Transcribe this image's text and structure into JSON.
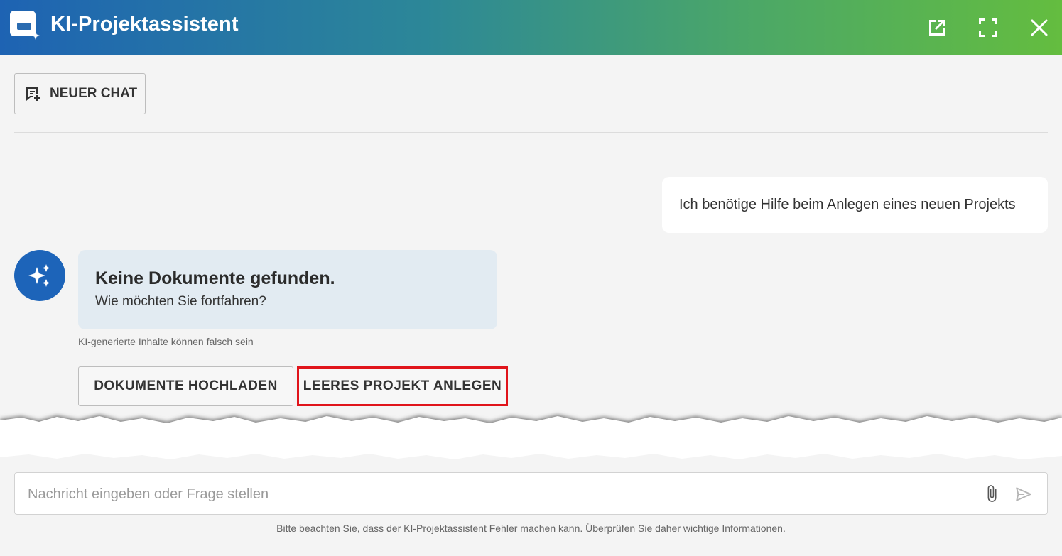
{
  "header": {
    "title": "KI-Projektassistent",
    "gradient_start": "#1e63b3",
    "gradient_end": "#64bd3f",
    "icons": [
      "logo-icon",
      "open-external-icon",
      "fullscreen-icon",
      "close-icon"
    ]
  },
  "toolbar": {
    "new_chat_label": "NEUER CHAT"
  },
  "conversation": {
    "user_message": "Ich benötige Hilfe beim Anlegen eines neuen Projekts",
    "bot_title": "Keine Dokumente gefunden.",
    "bot_subtitle": "Wie möchten Sie fortfahren?",
    "ai_note": "KI-generierte Inhalte können falsch sein",
    "actions": [
      {
        "label": "DOKUMENTE HOCHLADEN"
      },
      {
        "label": "LEERES PROJEKT ANLEGEN",
        "highlight_color": "#e0141b"
      }
    ]
  },
  "composer": {
    "placeholder": "Nachricht eingeben oder Frage stellen",
    "disclaimer": "Bitte beachten Sie, dass der KI-Projektassistent Fehler machen kann. Überprüfen Sie daher wichtige Informationen."
  },
  "colors": {
    "accent": "#1d64b9",
    "bot_bubble": "#e2ebf2",
    "highlight": "#e0141b"
  }
}
